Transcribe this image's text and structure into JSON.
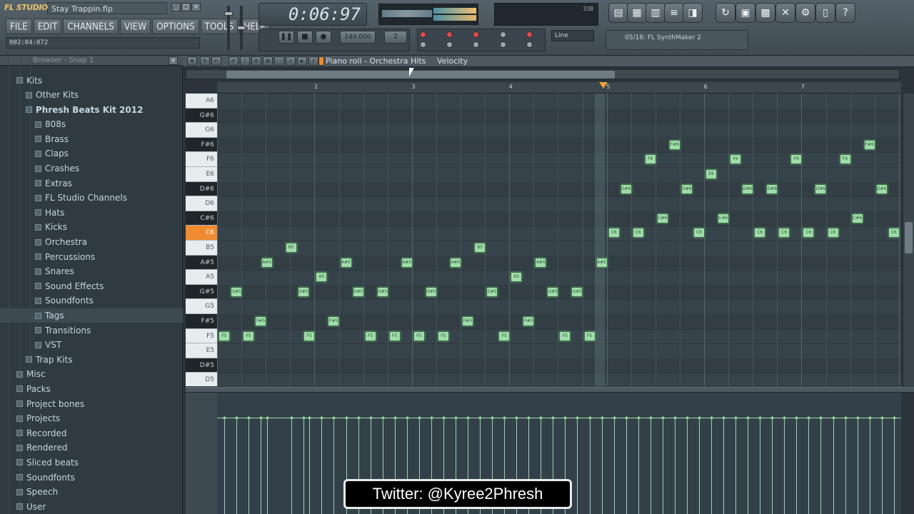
{
  "app": {
    "logo": "FL STUDIO",
    "filename": "Stay Trappin.flp",
    "song_time": "002:04:072",
    "clock": "0:06:97",
    "tempo": "140.000",
    "pattern": "2",
    "snap": "Line",
    "channel": "05/18: FL SynthMaker 2",
    "cpu": "338"
  },
  "menu": [
    "FILE",
    "EDIT",
    "CHANNELS",
    "VIEW",
    "OPTIONS",
    "TOOLS",
    "HELP"
  ],
  "browser": {
    "title": "Browser - Snap 1",
    "items": [
      {
        "label": "Kits",
        "indent": 1,
        "bold": false
      },
      {
        "label": "Other Kits",
        "indent": 2,
        "bold": false
      },
      {
        "label": "Phresh Beats Kit 2012",
        "indent": 2,
        "bold": true
      },
      {
        "label": "808s",
        "indent": 3,
        "bold": false
      },
      {
        "label": "Brass",
        "indent": 3,
        "bold": false
      },
      {
        "label": "Claps",
        "indent": 3,
        "bold": false
      },
      {
        "label": "Crashes",
        "indent": 3,
        "bold": false
      },
      {
        "label": "Extras",
        "indent": 3,
        "bold": false
      },
      {
        "label": "FL Studio Channels",
        "indent": 3,
        "bold": false
      },
      {
        "label": "Hats",
        "indent": 3,
        "bold": false
      },
      {
        "label": "Kicks",
        "indent": 3,
        "bold": false
      },
      {
        "label": "Orchestra",
        "indent": 3,
        "bold": false
      },
      {
        "label": "Percussions",
        "indent": 3,
        "bold": false
      },
      {
        "label": "Snares",
        "indent": 3,
        "bold": false
      },
      {
        "label": "Sound Effects",
        "indent": 3,
        "bold": false
      },
      {
        "label": "Soundfonts",
        "indent": 3,
        "bold": false
      },
      {
        "label": "Tags",
        "indent": 3,
        "bold": false,
        "selected": true
      },
      {
        "label": "Transitions",
        "indent": 3,
        "bold": false
      },
      {
        "label": "VST",
        "indent": 3,
        "bold": false
      },
      {
        "label": "Trap Kits",
        "indent": 2,
        "bold": false
      },
      {
        "label": "Misc",
        "indent": 1,
        "bold": false
      },
      {
        "label": "Packs",
        "indent": 1,
        "bold": false
      },
      {
        "label": "Project bones",
        "indent": 1,
        "bold": false
      },
      {
        "label": "Projects",
        "indent": 1,
        "bold": false
      },
      {
        "label": "Recorded",
        "indent": 1,
        "bold": false
      },
      {
        "label": "Rendered",
        "indent": 1,
        "bold": false
      },
      {
        "label": "Sliced beats",
        "indent": 1,
        "bold": false
      },
      {
        "label": "Soundfonts",
        "indent": 1,
        "bold": false
      },
      {
        "label": "Speech",
        "indent": 1,
        "bold": false
      },
      {
        "label": "User",
        "indent": 1,
        "bold": false
      }
    ]
  },
  "piano_roll": {
    "title": "Piano roll - Orchestra Hits",
    "velocity_label": "Velocity",
    "ruler_numbers": [
      "2",
      "3",
      "4",
      "5",
      "6",
      "7"
    ],
    "keys": [
      "A6",
      "G#6",
      "G6",
      "F#6",
      "F6",
      "E6",
      "D#6",
      "D6",
      "C#6",
      "C6",
      "B5",
      "A#5",
      "A5",
      "G#5",
      "G5",
      "F#5",
      "F5",
      "E5",
      "D#5",
      "D5"
    ],
    "black_keys": [
      "G#6",
      "F#6",
      "D#6",
      "C#6",
      "A#5",
      "G#5",
      "F#5",
      "D#5"
    ],
    "highlight_key": "C6",
    "notes": [
      {
        "pitch": "G#5",
        "step": 0.5,
        "label": "G#5"
      },
      {
        "pitch": "F5",
        "step": 0,
        "label": "F5"
      },
      {
        "pitch": "F5",
        "step": 1,
        "label": "F5"
      },
      {
        "pitch": "F#5",
        "step": 1.5,
        "label": "F#5"
      },
      {
        "pitch": "A#5",
        "step": 1.75,
        "label": "A#5"
      },
      {
        "pitch": "B5",
        "step": 2.75,
        "label": "B5"
      },
      {
        "pitch": "G#5",
        "step": 3.25,
        "label": "G#5"
      },
      {
        "pitch": "F5",
        "step": 3.5,
        "label": "F5"
      },
      {
        "pitch": "A5",
        "step": 4,
        "label": "A5"
      },
      {
        "pitch": "F#5",
        "step": 4.5,
        "label": "F#5"
      },
      {
        "pitch": "A#5",
        "step": 5,
        "label": "A#5"
      },
      {
        "pitch": "G#5",
        "step": 5.5,
        "label": "G#5"
      },
      {
        "pitch": "F5",
        "step": 6,
        "label": "F5"
      },
      {
        "pitch": "G#5",
        "step": 6.5,
        "label": "G#5"
      },
      {
        "pitch": "F5",
        "step": 7,
        "label": "F5"
      },
      {
        "pitch": "A#5",
        "step": 7.5,
        "label": "A#5"
      },
      {
        "pitch": "F5",
        "step": 8,
        "label": "F5"
      },
      {
        "pitch": "F5",
        "step": 9,
        "label": "F5"
      },
      {
        "pitch": "G#5",
        "step": 8.5,
        "label": "G#5"
      },
      {
        "pitch": "A#5",
        "step": 9.5,
        "label": "A#5"
      },
      {
        "pitch": "F#5",
        "step": 10,
        "label": "F#5"
      },
      {
        "pitch": "B5",
        "step": 10.5,
        "label": "B5"
      },
      {
        "pitch": "G#5",
        "step": 11,
        "label": "G#5"
      },
      {
        "pitch": "F5",
        "step": 11.5,
        "label": "F5"
      },
      {
        "pitch": "A5",
        "step": 12,
        "label": "A5"
      },
      {
        "pitch": "F#5",
        "step": 12.5,
        "label": "F#5"
      },
      {
        "pitch": "A#5",
        "step": 13,
        "label": "A#5"
      },
      {
        "pitch": "G#5",
        "step": 13.5,
        "label": "G#5"
      },
      {
        "pitch": "F5",
        "step": 14,
        "label": "F5"
      },
      {
        "pitch": "G#5",
        "step": 14.5,
        "label": "G#5"
      },
      {
        "pitch": "F5",
        "step": 15,
        "label": "F5"
      },
      {
        "pitch": "A#5",
        "step": 15.5,
        "label": "A#5"
      },
      {
        "pitch": "C6",
        "step": 16,
        "label": "C6"
      },
      {
        "pitch": "D#6",
        "step": 16.5,
        "label": "D#6"
      },
      {
        "pitch": "C6",
        "step": 17,
        "label": "C6"
      },
      {
        "pitch": "F6",
        "step": 17.5,
        "label": "F6"
      },
      {
        "pitch": "C#6",
        "step": 18,
        "label": "C#6"
      },
      {
        "pitch": "F#6",
        "step": 18.5,
        "label": "F#6"
      },
      {
        "pitch": "D#6",
        "step": 19,
        "label": "D#6"
      },
      {
        "pitch": "C6",
        "step": 19.5,
        "label": "C6"
      },
      {
        "pitch": "E6",
        "step": 20,
        "label": "E6"
      },
      {
        "pitch": "C#6",
        "step": 20.5,
        "label": "C#6"
      },
      {
        "pitch": "F6",
        "step": 21,
        "label": "F6"
      },
      {
        "pitch": "D#6",
        "step": 21.5,
        "label": "D#6"
      },
      {
        "pitch": "C6",
        "step": 22,
        "label": "C6"
      },
      {
        "pitch": "D#6",
        "step": 22.5,
        "label": "D#6"
      },
      {
        "pitch": "C6",
        "step": 23,
        "label": "C6"
      },
      {
        "pitch": "F6",
        "step": 23.5,
        "label": "F6"
      },
      {
        "pitch": "C6",
        "step": 24,
        "label": "C6"
      },
      {
        "pitch": "D#6",
        "step": 24.5,
        "label": "D#6"
      },
      {
        "pitch": "C6",
        "step": 25,
        "label": "C6"
      },
      {
        "pitch": "F6",
        "step": 25.5,
        "label": "F6"
      },
      {
        "pitch": "C#6",
        "step": 26,
        "label": "C#6"
      },
      {
        "pitch": "F#6",
        "step": 26.5,
        "label": "F#6"
      },
      {
        "pitch": "D#6",
        "step": 27,
        "label": "D#6"
      },
      {
        "pitch": "C6",
        "step": 27.5,
        "label": "C6"
      }
    ]
  },
  "overlay": {
    "twitter": "Twitter: @Kyree2Phresh"
  },
  "colors": {
    "note": "#9fdcaa",
    "highlight_key": "#f08b2f",
    "marker": "#f2a23c"
  }
}
